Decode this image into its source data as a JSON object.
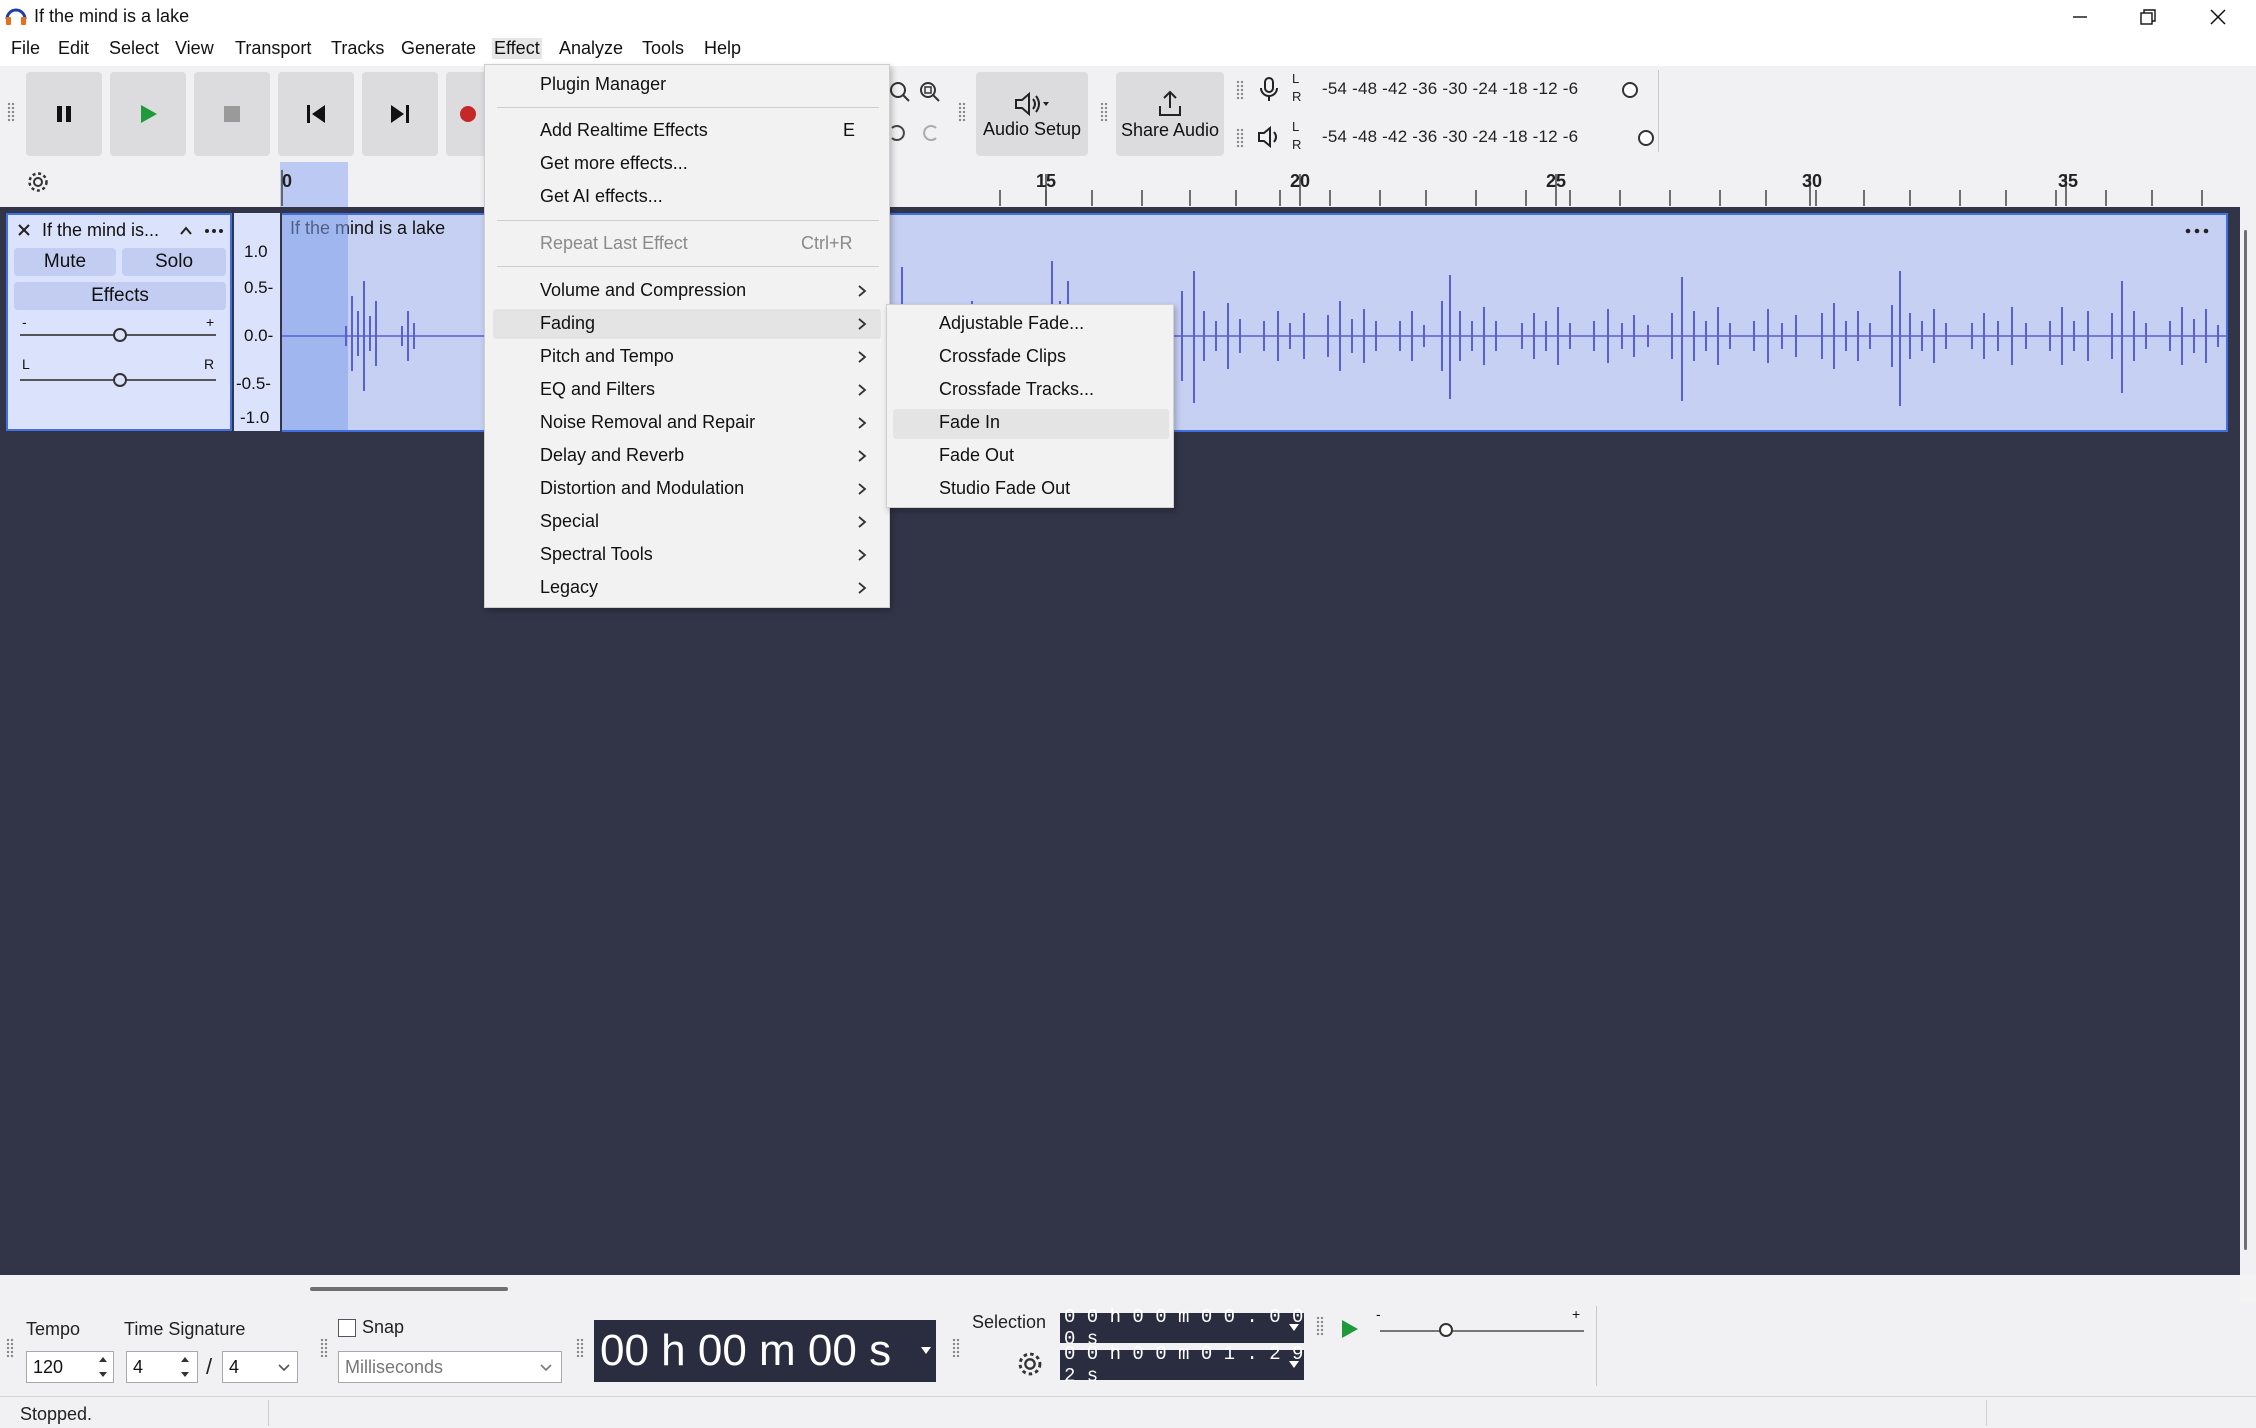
{
  "window": {
    "title": "If the mind is a lake"
  },
  "menubar": {
    "items": [
      "File",
      "Edit",
      "Select",
      "View",
      "Transport",
      "Tracks",
      "Generate",
      "Effect",
      "Analyze",
      "Tools",
      "Help"
    ]
  },
  "toolbar": {
    "audio_setup_label": "Audio Setup",
    "share_audio_label": "Share Audio",
    "meter_scale": "-54 -48 -42 -36 -30 -24 -18 -12 -6",
    "meter_l": "L",
    "meter_r": "R"
  },
  "ruler": {
    "labels": [
      "0",
      "15",
      "20",
      "25",
      "30",
      "35"
    ]
  },
  "track": {
    "name": "If the mind is...",
    "clip_name": "If the mind is a lake",
    "mute_label": "Mute",
    "solo_label": "Solo",
    "effects_label": "Effects",
    "gain_minus": "-",
    "gain_plus": "+",
    "pan_left": "L",
    "pan_right": "R",
    "vruler": [
      "1.0",
      "0.5-",
      "0.0-",
      "-0.5-",
      "-1.0"
    ]
  },
  "effect_menu": {
    "plugin_manager": "Plugin Manager",
    "add_realtime": "Add Realtime Effects",
    "add_realtime_shortcut": "E",
    "get_more": "Get more effects...",
    "get_ai": "Get AI effects...",
    "repeat_last": "Repeat Last Effect",
    "repeat_last_shortcut": "Ctrl+R",
    "categories": [
      "Volume and Compression",
      "Fading",
      "Pitch and Tempo",
      "EQ and Filters",
      "Noise Removal and Repair",
      "Delay and Reverb",
      "Distortion and Modulation",
      "Special",
      "Spectral Tools",
      "Legacy"
    ]
  },
  "fading_submenu": {
    "items": [
      "Adjustable Fade...",
      "Crossfade Clips",
      "Crossfade Tracks...",
      "Fade In",
      "Fade Out",
      "Studio Fade Out"
    ],
    "highlighted": "Fade In"
  },
  "bottom": {
    "tempo_label": "Tempo",
    "tempo_value": "120",
    "time_signature_label": "Time Signature",
    "time_sig_upper": "4",
    "time_sig_slash": "/",
    "time_sig_lower": "4",
    "snap_label": "Snap",
    "snap_unit": "Milliseconds",
    "time_display": "00 h 00 m 00 s",
    "selection_label": "Selection",
    "selection_start": "0 0 h 0 0 m 0 0 . 0 0 0 s",
    "selection_end": "0 0 h 0 0 m 0 1 . 2 9 2 s",
    "speed_minus": "-",
    "speed_plus": "+"
  },
  "status": {
    "text": "Stopped."
  },
  "colors": {
    "waveform": "#5a5fd6",
    "track_bg": "#323548",
    "clip_bg": "#c6d0f3",
    "selection_border": "#3f6fe0"
  }
}
